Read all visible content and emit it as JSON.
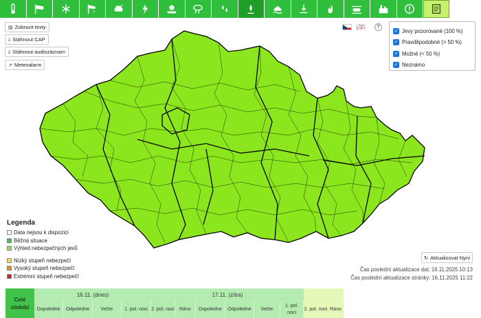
{
  "hazard_icons": [
    {
      "name": "temperature-icon"
    },
    {
      "name": "wind-icon"
    },
    {
      "name": "snow-ice-icon"
    },
    {
      "name": "blizzard-icon"
    },
    {
      "name": "road-conditions-icon"
    },
    {
      "name": "thunderstorm-icon"
    },
    {
      "name": "heat-icon"
    },
    {
      "name": "rain-cloud-icon"
    },
    {
      "name": "rain-drops-icon"
    },
    {
      "name": "freezing-rain-icon"
    },
    {
      "name": "flood-icon"
    },
    {
      "name": "flash-flood-icon"
    },
    {
      "name": "fire-icon"
    },
    {
      "name": "fog-car-icon"
    },
    {
      "name": "smog-icon"
    },
    {
      "name": "warning-icon"
    },
    {
      "name": "text-document-icon"
    }
  ],
  "buttons": {
    "show_texts": "Zobrazit texty",
    "download_cap": "Stáhnout CAP",
    "download_audio": "Stáhnout audiozáznam",
    "meteoalarm": "Meteoalarm"
  },
  "filters": [
    {
      "label": "Jevy pozorované (100 %)",
      "checked": true
    },
    {
      "label": "Pravděpodobné (> 50 %)",
      "checked": true
    },
    {
      "label": "Možné (< 50 %)",
      "checked": true
    },
    {
      "label": "Neznámo",
      "checked": true
    }
  ],
  "help_label": "?",
  "legend": {
    "title": "Legenda",
    "items": [
      {
        "label": "Data nejsou k dispozici",
        "color": "#ffffff"
      },
      {
        "label": "Běžná situace",
        "color": "#3fbf4c"
      },
      {
        "label": "Výhled nebezpečných jevů",
        "color": "#8fe04a"
      },
      {
        "label": "Nízký stupeň nebezpečí",
        "color": "#f2e233"
      },
      {
        "label": "Vysoký stupeň nebezpečí",
        "color": "#e88d1e"
      },
      {
        "label": "Extrémní stupeň nebezpečí",
        "color": "#d62020"
      }
    ]
  },
  "update": {
    "button": "Aktualizovat Nyní",
    "data_time": "Čas poslední aktualizace dat: 16.11.2025 10:13",
    "page_time": "Čas poslední aktualizace stránky: 16.11.2025 11:22"
  },
  "timeline": {
    "whole_period": "Celé období",
    "day1": "16.11. (dnes)",
    "day2": "17.11. (zítra)",
    "cells": [
      "Dopoledne",
      "Odpoledne",
      "Večer",
      "1. pol. noci",
      "2. pol. noci",
      "Ráno",
      "Dopoledne",
      "Odpoledne",
      "Večer",
      "1. pol. noci",
      "2. pol. noci",
      "Ráno"
    ]
  },
  "colors": {
    "map_fill": "#8ce61e",
    "icon_bar": "#2fbf3c",
    "active_tab": "#c8f06c"
  }
}
